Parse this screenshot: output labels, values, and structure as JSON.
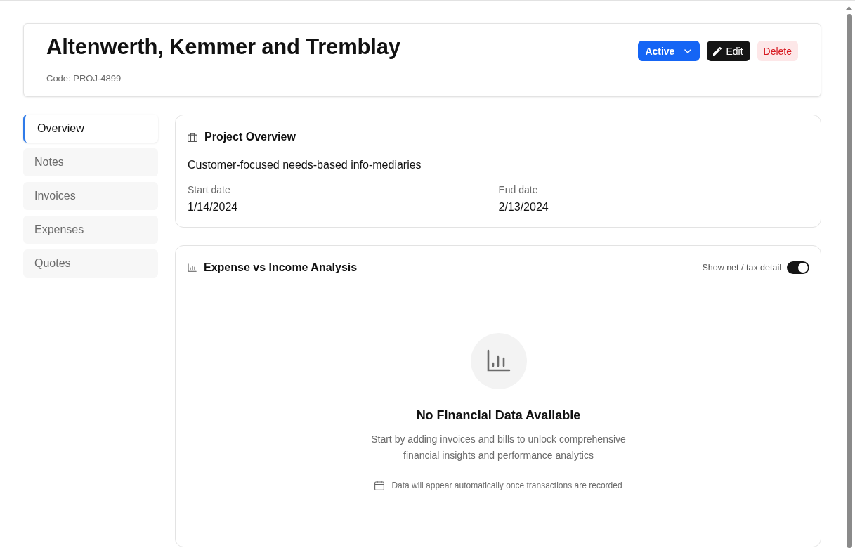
{
  "header": {
    "title": "Altenwerth, Kemmer and Tremblay",
    "code": "Code: PROJ-4899",
    "status": {
      "label": "Active"
    },
    "buttons": [
      {
        "label": "Edit",
        "kind": "edit"
      },
      {
        "label": "Delete",
        "kind": "delete"
      }
    ]
  },
  "sidebar": {
    "items": [
      {
        "label": "Overview",
        "selected": true
      },
      {
        "label": "Notes",
        "selected": false
      },
      {
        "label": "Invoices",
        "selected": false
      },
      {
        "label": "Expenses",
        "selected": false
      },
      {
        "label": "Quotes",
        "selected": false
      }
    ]
  },
  "overview": {
    "title": "Project Overview",
    "description": "Customer-focused needs-based info-mediaries",
    "fields": [
      {
        "label": "Start date",
        "value": "1/14/2024"
      },
      {
        "label": "End date",
        "value": "2/13/2024"
      }
    ]
  },
  "analysis": {
    "title": "Expense vs Income Analysis",
    "toggle": {
      "label": "Show net / tax detail",
      "on": true
    },
    "empty_state": {
      "title": "No Financial Data Available",
      "description": "Start by adding invoices and bills to unlock comprehensive financial insights and performance analytics",
      "note": "Data will appear automatically once transactions are recorded"
    }
  }
}
